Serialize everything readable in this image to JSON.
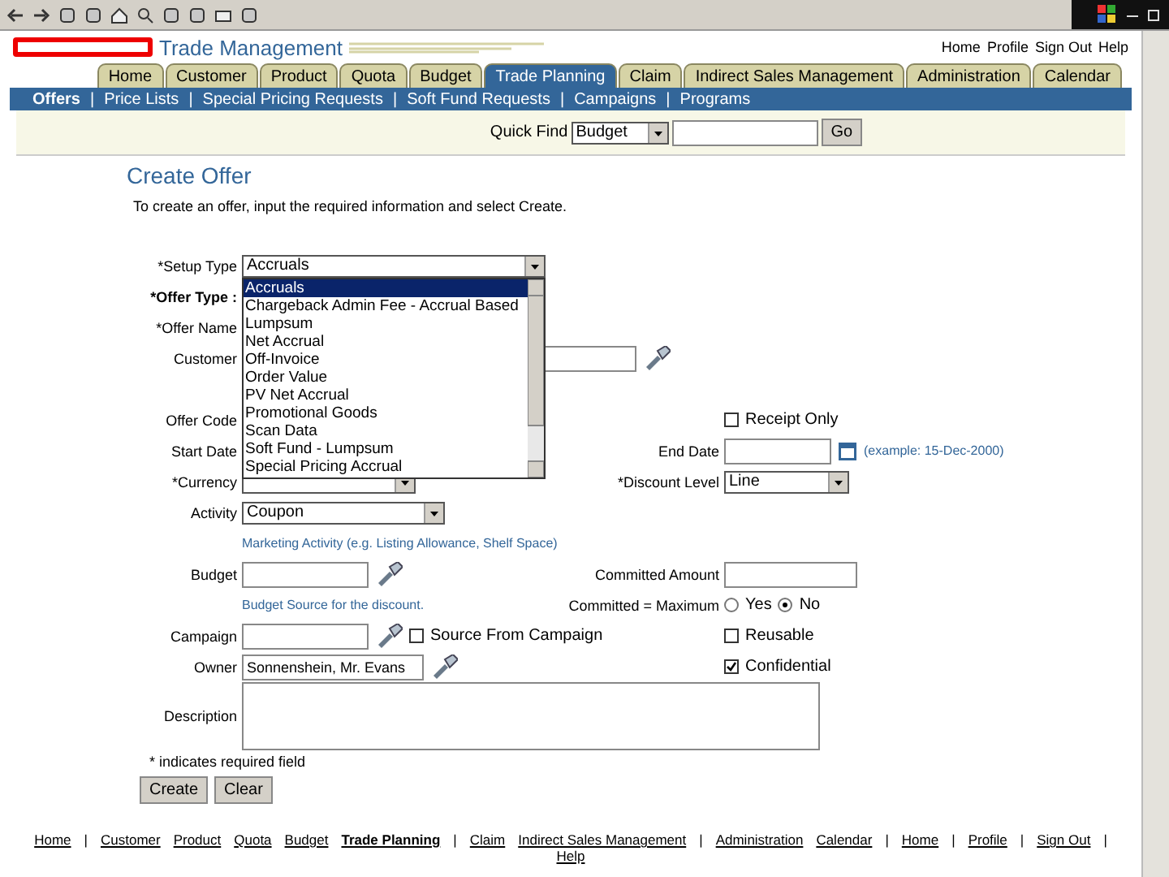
{
  "header": {
    "product": "Trade Management",
    "global_links": [
      "Home",
      "Profile",
      "Sign Out",
      "Help"
    ]
  },
  "tabs": [
    {
      "label": "Home",
      "selected": false
    },
    {
      "label": "Customer",
      "selected": false
    },
    {
      "label": "Product",
      "selected": false
    },
    {
      "label": "Quota",
      "selected": false
    },
    {
      "label": "Budget",
      "selected": false
    },
    {
      "label": "Trade Planning",
      "selected": true
    },
    {
      "label": "Claim",
      "selected": false
    },
    {
      "label": "Indirect Sales Management",
      "selected": false
    },
    {
      "label": "Administration",
      "selected": false
    },
    {
      "label": "Calendar",
      "selected": false
    }
  ],
  "subtab_separator": "|",
  "subtabs": [
    {
      "label": "Offers",
      "selected": true
    },
    {
      "label": "Price Lists",
      "selected": false
    },
    {
      "label": "Special Pricing Requests",
      "selected": false
    },
    {
      "label": "Soft Fund Requests",
      "selected": false
    },
    {
      "label": "Campaigns",
      "selected": false
    },
    {
      "label": "Programs",
      "selected": false
    }
  ],
  "quick_find": {
    "label": "Quick Find",
    "value": "Budget",
    "button": "Go"
  },
  "page": {
    "title": "Create Offer",
    "instruction": "To create an offer, input the required information and select Create."
  },
  "form": {
    "setup_type": {
      "label": "*Setup Type",
      "value": "Accruals"
    },
    "setup_type_options": [
      {
        "label": "Accruals",
        "selected": true
      },
      {
        "label": "Chargeback Admin Fee - Accrual Based",
        "selected": false
      },
      {
        "label": "Lumpsum",
        "selected": false
      },
      {
        "label": "Net Accrual",
        "selected": false
      },
      {
        "label": "Off-Invoice",
        "selected": false
      },
      {
        "label": "Order Value",
        "selected": false
      },
      {
        "label": "PV Net Accrual",
        "selected": false
      },
      {
        "label": "Promotional Goods",
        "selected": false
      },
      {
        "label": "Scan Data",
        "selected": false
      },
      {
        "label": "Soft Fund - Lumpsum",
        "selected": false
      },
      {
        "label": "Special Pricing Accrual",
        "selected": false
      }
    ],
    "offer_type": {
      "label": "*Offer Type :"
    },
    "offer_name": {
      "label": "*Offer Name"
    },
    "customer": {
      "label": "Customer"
    },
    "offer_code": {
      "label": "Offer Code"
    },
    "receipt_only": {
      "label": "Receipt Only",
      "checked": false
    },
    "start_date": {
      "label": "Start Date"
    },
    "end_date": {
      "label": "End Date",
      "hint": "(example: 15-Dec-2000)"
    },
    "currency": {
      "label": "*Currency"
    },
    "discount_level": {
      "label": "*Discount Level",
      "value": "Line"
    },
    "activity": {
      "label": "Activity",
      "value": "Coupon",
      "hint": "Marketing Activity (e.g. Listing Allowance, Shelf Space)"
    },
    "budget": {
      "label": "Budget",
      "hint": "Budget Source for the discount."
    },
    "committed_amount": {
      "label": "Committed Amount"
    },
    "committed_max": {
      "label": "Committed = Maximum",
      "options": [
        {
          "label": "Yes",
          "selected": false
        },
        {
          "label": "No",
          "selected": true
        }
      ]
    },
    "campaign": {
      "label": "Campaign"
    },
    "source_from_campaign": {
      "label": "Source From Campaign",
      "checked": false
    },
    "reusable": {
      "label": "Reusable",
      "checked": false
    },
    "owner": {
      "label": "Owner",
      "value": "Sonnenshein, Mr. Evans"
    },
    "confidential": {
      "label": "Confidential",
      "checked": true
    },
    "description": {
      "label": "Description"
    },
    "required_note": "* indicates required field",
    "buttons": [
      "Create",
      "Clear"
    ]
  },
  "footer_links": [
    {
      "label": "Home",
      "bold": false,
      "separator": "|"
    },
    {
      "label": "Customer",
      "bold": false
    },
    {
      "label": "Product",
      "bold": false
    },
    {
      "label": "Quota",
      "bold": false
    },
    {
      "label": "Budget",
      "bold": false
    },
    {
      "label": "Trade Planning",
      "bold": true,
      "separator": "|"
    },
    {
      "label": "Claim",
      "bold": false
    },
    {
      "label": "Indirect Sales Management",
      "bold": false,
      "separator": "|"
    },
    {
      "label": "Administration",
      "bold": false
    },
    {
      "label": "Calendar",
      "bold": false,
      "separator": "|"
    },
    {
      "label": "Home",
      "bold": false,
      "separator": "|"
    },
    {
      "label": "Profile",
      "bold": false,
      "separator": "|"
    },
    {
      "label": "Sign Out",
      "bold": false,
      "separator": "|"
    },
    {
      "label": "Help",
      "bold": false
    }
  ]
}
